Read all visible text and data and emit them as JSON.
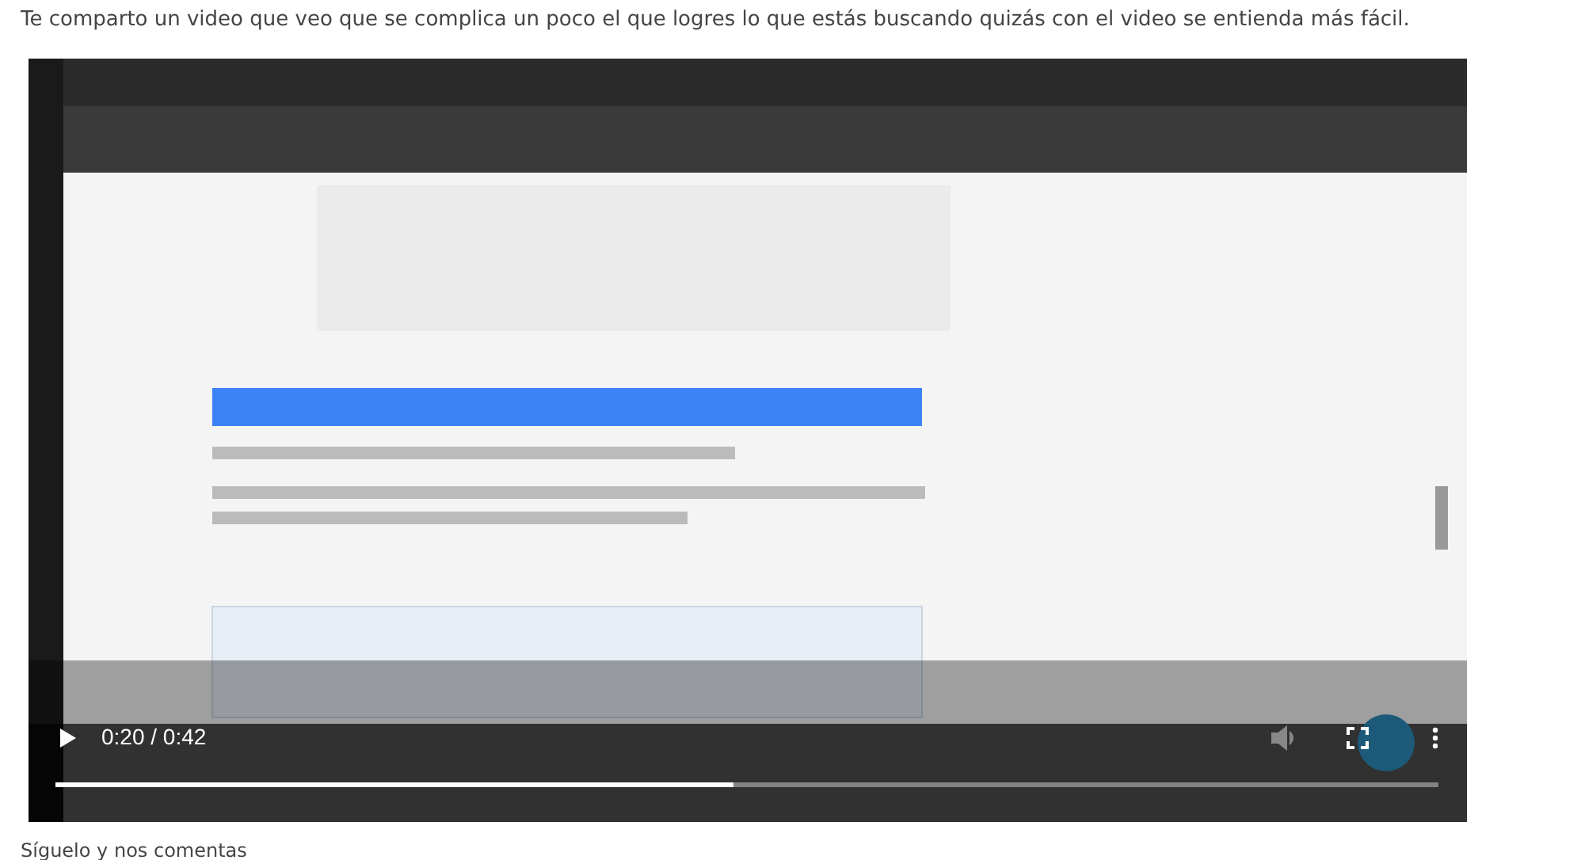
{
  "intro": "Te comparto un video que veo que se complica un poco el que logres lo que estás buscando quizás con el video se entienda más fácil.",
  "video": {
    "playing": false,
    "time": "0:20 / 0:42",
    "progress": {
      "level": 0.49
    }
  },
  "outro": "Síguelo y nos comentas"
}
